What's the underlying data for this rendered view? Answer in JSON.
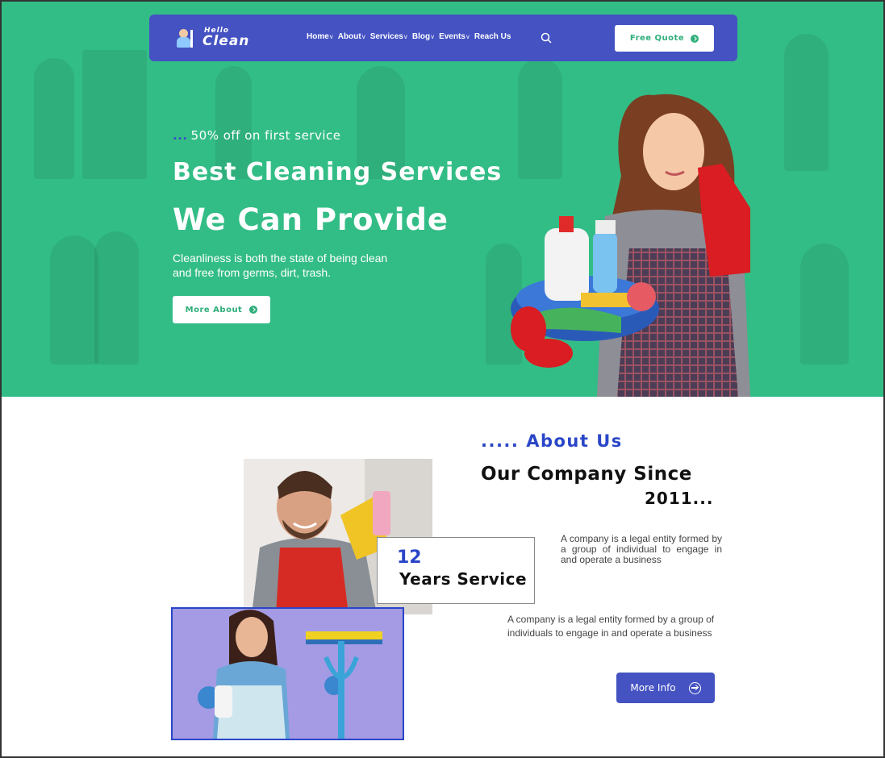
{
  "colors": {
    "hero_bg": "#33bd86",
    "nav_bg": "#4452c2",
    "accent_blue": "#2a46c7",
    "button_text_green": "#2fae7a"
  },
  "nav": {
    "logo_hello": "Hello",
    "logo_clean": "Clean",
    "menu": [
      {
        "label": "Home",
        "has_dropdown": true
      },
      {
        "label": "About",
        "has_dropdown": true
      },
      {
        "label": "Services",
        "has_dropdown": true
      },
      {
        "label": "Blog",
        "has_dropdown": true
      },
      {
        "label": "Events",
        "has_dropdown": true
      },
      {
        "label": "Reach Us",
        "has_dropdown": false
      }
    ],
    "search_icon": "search-icon",
    "quote_label": "Free Quote"
  },
  "hero": {
    "offer_dots": "...",
    "offer": "50% off on first service",
    "headline1": "Best Cleaning Services",
    "headline2": "We Can Provide",
    "description": "Cleanliness is both the state of being clean and free from germs, dirt, trash.",
    "button_label": "More About"
  },
  "about": {
    "title": "..... About Us",
    "company_line1": "Our Company Since",
    "company_line2": "2011...",
    "years_number": "12",
    "years_label": "Years Service",
    "desc1": "A company is a legal entity formed by a group of individual to engage in and operate a business",
    "desc2": "A company is a legal entity formed by a group of individuals to engage in and operate a business",
    "button_label": "More Info"
  }
}
